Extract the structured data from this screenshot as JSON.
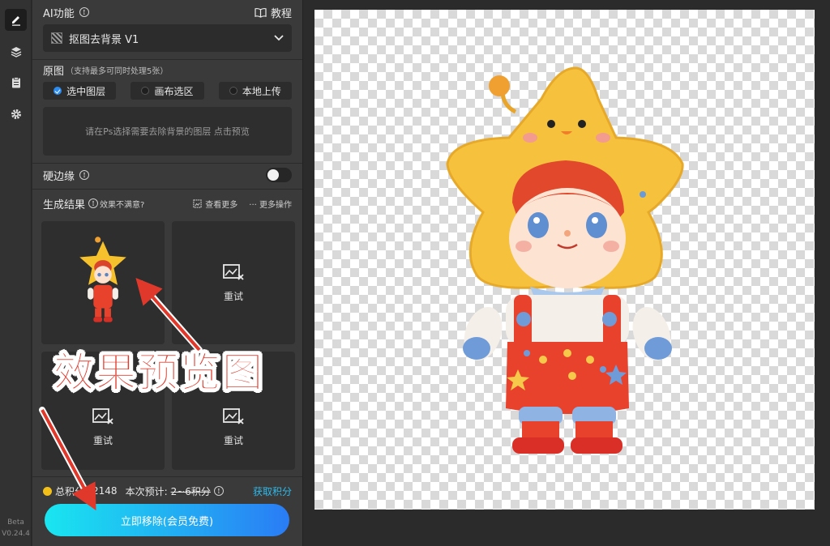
{
  "sidebar": {
    "version_beta": "Beta",
    "version_number": "V0.24.4"
  },
  "ai_function": {
    "label": "AI功能",
    "tutorial": "教程",
    "selected_mode": "抠图去背景 V1"
  },
  "source": {
    "label": "原图",
    "hint": "（支持最多可同时处理5张）",
    "options": [
      "选中图层",
      "画布选区",
      "本地上传"
    ],
    "selected_index": 0,
    "dropzone_text": "请在Ps选择需要去除背景的图层 点击预览"
  },
  "hard_edge": {
    "label": "硬边缘",
    "enabled": false
  },
  "results": {
    "label": "生成结果",
    "unsatisfied": "效果不满意?",
    "view_more": "查看更多",
    "more_actions": "··· 更多操作",
    "retry_label": "重试"
  },
  "credits": {
    "total_label": "总积分",
    "total_value": "2148",
    "estimate_label": "本次预计:",
    "estimate_value": "2~6积分",
    "get_points": "获取积分"
  },
  "action": {
    "remove_button": "立即移除(会员免费)"
  },
  "annotation": {
    "callout": "效果预览图"
  },
  "colors": {
    "accent_blue": "#2d8cf0",
    "cta_gradient_start": "#19e6f0",
    "cta_gradient_end": "#2a7cf5",
    "annotation_red": "#e0392b",
    "link_cyan": "#2fb9ea"
  }
}
